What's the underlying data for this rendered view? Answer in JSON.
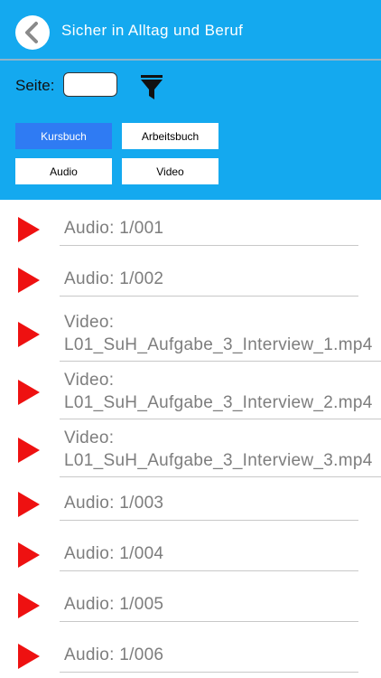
{
  "header": {
    "title": "Sicher in Alltag und Beruf",
    "page_label": "Seite:",
    "page_value": "",
    "accent_color": "#14a9ef"
  },
  "filters": [
    {
      "label": "Kursbuch",
      "active": true
    },
    {
      "label": "Arbeitsbuch",
      "active": false
    },
    {
      "label": "Audio",
      "active": false
    },
    {
      "label": "Video",
      "active": false
    }
  ],
  "items": [
    {
      "line1": "Audio: 1/001",
      "line2": ""
    },
    {
      "line1": "Audio: 1/002",
      "line2": ""
    },
    {
      "line1": "Video:",
      "line2": "L01_SuH_Aufgabe_3_Interview_1.mp4"
    },
    {
      "line1": "Video:",
      "line2": "L01_SuH_Aufgabe_3_Interview_2.mp4"
    },
    {
      "line1": "Video:",
      "line2": "L01_SuH_Aufgabe_3_Interview_3.mp4"
    },
    {
      "line1": "Audio: 1/003",
      "line2": ""
    },
    {
      "line1": "Audio: 1/004",
      "line2": ""
    },
    {
      "line1": "Audio: 1/005",
      "line2": ""
    },
    {
      "line1": "Audio: 1/006",
      "line2": ""
    }
  ],
  "icons": {
    "back": "chevron-left-icon",
    "filter": "funnel-icon",
    "play": "play-icon",
    "play_color": "#ee1111"
  }
}
